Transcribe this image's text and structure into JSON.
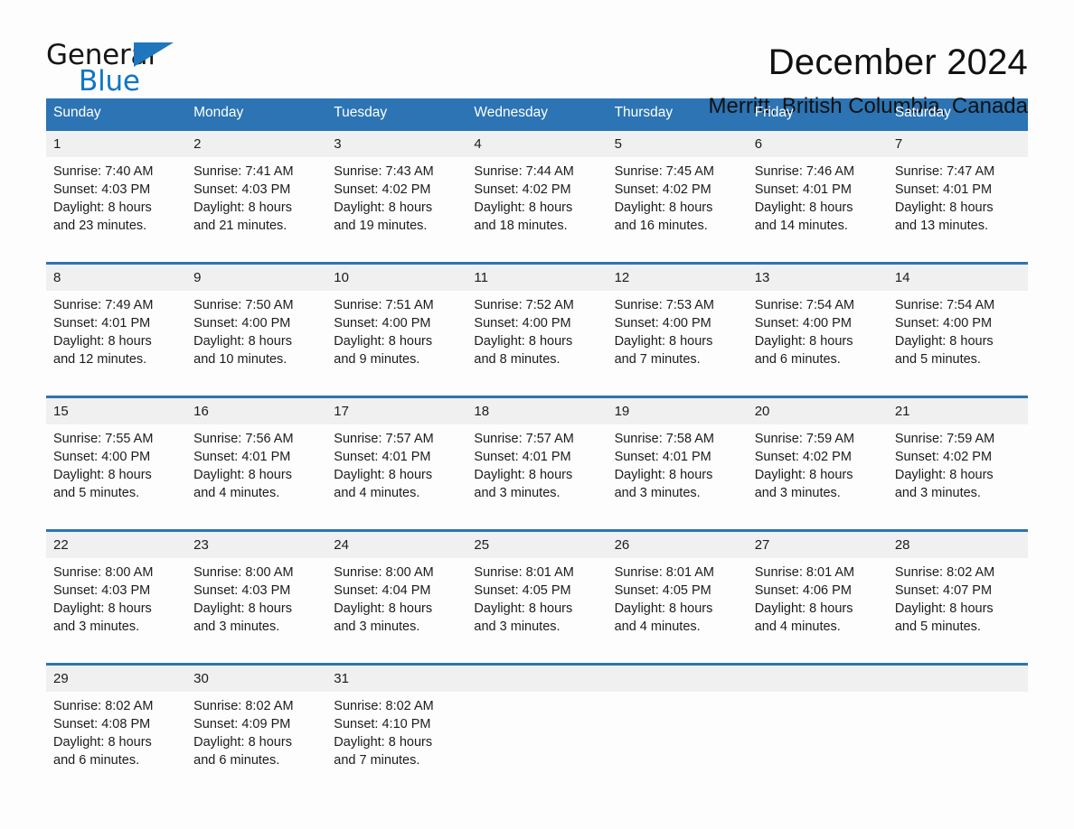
{
  "brand": {
    "name_primary": "General",
    "name_secondary": "Blue",
    "primary_color": "#161616",
    "secondary_color": "#0f76c3",
    "triangle_color": "#1f76bd",
    "triangle_icon": "triangle-icon"
  },
  "header": {
    "month_title": "December 2024",
    "location": "Merritt, British Columbia, Canada"
  },
  "theme": {
    "header_row_bg": "#2c74b3",
    "header_row_text": "#ffffff",
    "daynum_bg": "#f0f0f0",
    "row_separator": "#2c74b3",
    "page_bg": "#fdfdfd",
    "body_text": "#1c1c1c"
  },
  "calendar": {
    "weekday_headers": [
      "Sunday",
      "Monday",
      "Tuesday",
      "Wednesday",
      "Thursday",
      "Friday",
      "Saturday"
    ],
    "weeks": [
      {
        "days": [
          {
            "date": "1",
            "sunrise": "Sunrise: 7:40 AM",
            "sunset": "Sunset: 4:03 PM",
            "daylight_line1": "Daylight: 8 hours",
            "daylight_line2": "and 23 minutes."
          },
          {
            "date": "2",
            "sunrise": "Sunrise: 7:41 AM",
            "sunset": "Sunset: 4:03 PM",
            "daylight_line1": "Daylight: 8 hours",
            "daylight_line2": "and 21 minutes."
          },
          {
            "date": "3",
            "sunrise": "Sunrise: 7:43 AM",
            "sunset": "Sunset: 4:02 PM",
            "daylight_line1": "Daylight: 8 hours",
            "daylight_line2": "and 19 minutes."
          },
          {
            "date": "4",
            "sunrise": "Sunrise: 7:44 AM",
            "sunset": "Sunset: 4:02 PM",
            "daylight_line1": "Daylight: 8 hours",
            "daylight_line2": "and 18 minutes."
          },
          {
            "date": "5",
            "sunrise": "Sunrise: 7:45 AM",
            "sunset": "Sunset: 4:02 PM",
            "daylight_line1": "Daylight: 8 hours",
            "daylight_line2": "and 16 minutes."
          },
          {
            "date": "6",
            "sunrise": "Sunrise: 7:46 AM",
            "sunset": "Sunset: 4:01 PM",
            "daylight_line1": "Daylight: 8 hours",
            "daylight_line2": "and 14 minutes."
          },
          {
            "date": "7",
            "sunrise": "Sunrise: 7:47 AM",
            "sunset": "Sunset: 4:01 PM",
            "daylight_line1": "Daylight: 8 hours",
            "daylight_line2": "and 13 minutes."
          }
        ]
      },
      {
        "days": [
          {
            "date": "8",
            "sunrise": "Sunrise: 7:49 AM",
            "sunset": "Sunset: 4:01 PM",
            "daylight_line1": "Daylight: 8 hours",
            "daylight_line2": "and 12 minutes."
          },
          {
            "date": "9",
            "sunrise": "Sunrise: 7:50 AM",
            "sunset": "Sunset: 4:00 PM",
            "daylight_line1": "Daylight: 8 hours",
            "daylight_line2": "and 10 minutes."
          },
          {
            "date": "10",
            "sunrise": "Sunrise: 7:51 AM",
            "sunset": "Sunset: 4:00 PM",
            "daylight_line1": "Daylight: 8 hours",
            "daylight_line2": "and 9 minutes."
          },
          {
            "date": "11",
            "sunrise": "Sunrise: 7:52 AM",
            "sunset": "Sunset: 4:00 PM",
            "daylight_line1": "Daylight: 8 hours",
            "daylight_line2": "and 8 minutes."
          },
          {
            "date": "12",
            "sunrise": "Sunrise: 7:53 AM",
            "sunset": "Sunset: 4:00 PM",
            "daylight_line1": "Daylight: 8 hours",
            "daylight_line2": "and 7 minutes."
          },
          {
            "date": "13",
            "sunrise": "Sunrise: 7:54 AM",
            "sunset": "Sunset: 4:00 PM",
            "daylight_line1": "Daylight: 8 hours",
            "daylight_line2": "and 6 minutes."
          },
          {
            "date": "14",
            "sunrise": "Sunrise: 7:54 AM",
            "sunset": "Sunset: 4:00 PM",
            "daylight_line1": "Daylight: 8 hours",
            "daylight_line2": "and 5 minutes."
          }
        ]
      },
      {
        "days": [
          {
            "date": "15",
            "sunrise": "Sunrise: 7:55 AM",
            "sunset": "Sunset: 4:00 PM",
            "daylight_line1": "Daylight: 8 hours",
            "daylight_line2": "and 5 minutes."
          },
          {
            "date": "16",
            "sunrise": "Sunrise: 7:56 AM",
            "sunset": "Sunset: 4:01 PM",
            "daylight_line1": "Daylight: 8 hours",
            "daylight_line2": "and 4 minutes."
          },
          {
            "date": "17",
            "sunrise": "Sunrise: 7:57 AM",
            "sunset": "Sunset: 4:01 PM",
            "daylight_line1": "Daylight: 8 hours",
            "daylight_line2": "and 4 minutes."
          },
          {
            "date": "18",
            "sunrise": "Sunrise: 7:57 AM",
            "sunset": "Sunset: 4:01 PM",
            "daylight_line1": "Daylight: 8 hours",
            "daylight_line2": "and 3 minutes."
          },
          {
            "date": "19",
            "sunrise": "Sunrise: 7:58 AM",
            "sunset": "Sunset: 4:01 PM",
            "daylight_line1": "Daylight: 8 hours",
            "daylight_line2": "and 3 minutes."
          },
          {
            "date": "20",
            "sunrise": "Sunrise: 7:59 AM",
            "sunset": "Sunset: 4:02 PM",
            "daylight_line1": "Daylight: 8 hours",
            "daylight_line2": "and 3 minutes."
          },
          {
            "date": "21",
            "sunrise": "Sunrise: 7:59 AM",
            "sunset": "Sunset: 4:02 PM",
            "daylight_line1": "Daylight: 8 hours",
            "daylight_line2": "and 3 minutes."
          }
        ]
      },
      {
        "days": [
          {
            "date": "22",
            "sunrise": "Sunrise: 8:00 AM",
            "sunset": "Sunset: 4:03 PM",
            "daylight_line1": "Daylight: 8 hours",
            "daylight_line2": "and 3 minutes."
          },
          {
            "date": "23",
            "sunrise": "Sunrise: 8:00 AM",
            "sunset": "Sunset: 4:03 PM",
            "daylight_line1": "Daylight: 8 hours",
            "daylight_line2": "and 3 minutes."
          },
          {
            "date": "24",
            "sunrise": "Sunrise: 8:00 AM",
            "sunset": "Sunset: 4:04 PM",
            "daylight_line1": "Daylight: 8 hours",
            "daylight_line2": "and 3 minutes."
          },
          {
            "date": "25",
            "sunrise": "Sunrise: 8:01 AM",
            "sunset": "Sunset: 4:05 PM",
            "daylight_line1": "Daylight: 8 hours",
            "daylight_line2": "and 3 minutes."
          },
          {
            "date": "26",
            "sunrise": "Sunrise: 8:01 AM",
            "sunset": "Sunset: 4:05 PM",
            "daylight_line1": "Daylight: 8 hours",
            "daylight_line2": "and 4 minutes."
          },
          {
            "date": "27",
            "sunrise": "Sunrise: 8:01 AM",
            "sunset": "Sunset: 4:06 PM",
            "daylight_line1": "Daylight: 8 hours",
            "daylight_line2": "and 4 minutes."
          },
          {
            "date": "28",
            "sunrise": "Sunrise: 8:02 AM",
            "sunset": "Sunset: 4:07 PM",
            "daylight_line1": "Daylight: 8 hours",
            "daylight_line2": "and 5 minutes."
          }
        ]
      },
      {
        "days": [
          {
            "date": "29",
            "sunrise": "Sunrise: 8:02 AM",
            "sunset": "Sunset: 4:08 PM",
            "daylight_line1": "Daylight: 8 hours",
            "daylight_line2": "and 6 minutes."
          },
          {
            "date": "30",
            "sunrise": "Sunrise: 8:02 AM",
            "sunset": "Sunset: 4:09 PM",
            "daylight_line1": "Daylight: 8 hours",
            "daylight_line2": "and 6 minutes."
          },
          {
            "date": "31",
            "sunrise": "Sunrise: 8:02 AM",
            "sunset": "Sunset: 4:10 PM",
            "daylight_line1": "Daylight: 8 hours",
            "daylight_line2": "and 7 minutes."
          },
          {
            "date": "",
            "sunrise": "",
            "sunset": "",
            "daylight_line1": "",
            "daylight_line2": ""
          },
          {
            "date": "",
            "sunrise": "",
            "sunset": "",
            "daylight_line1": "",
            "daylight_line2": ""
          },
          {
            "date": "",
            "sunrise": "",
            "sunset": "",
            "daylight_line1": "",
            "daylight_line2": ""
          },
          {
            "date": "",
            "sunrise": "",
            "sunset": "",
            "daylight_line1": "",
            "daylight_line2": ""
          }
        ]
      }
    ]
  }
}
